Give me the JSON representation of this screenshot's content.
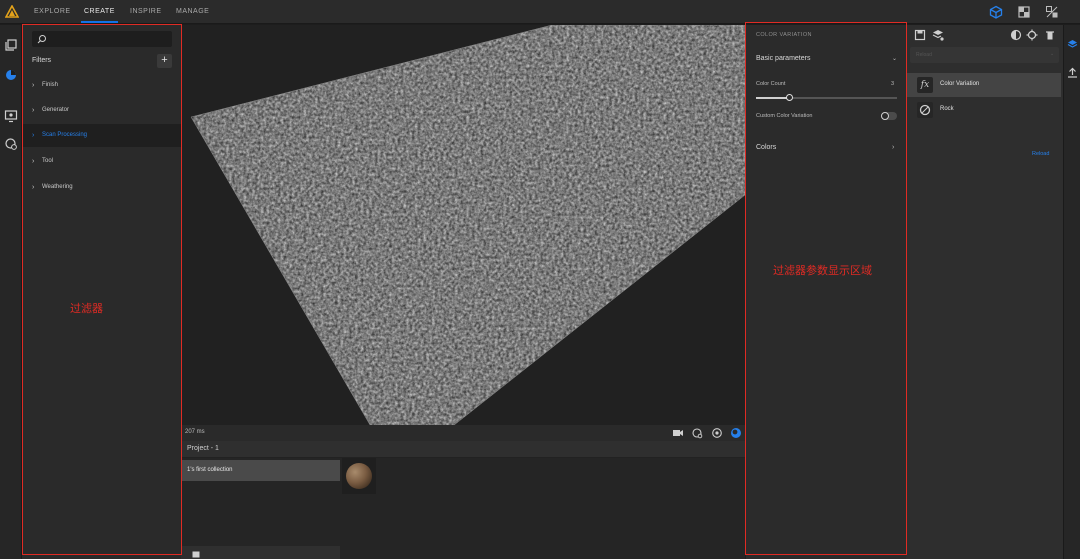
{
  "topbar": {
    "tabs": [
      "EXPLORE",
      "CREATE",
      "INSPIRE",
      "MANAGE"
    ],
    "active_tab": "CREATE"
  },
  "filters": {
    "search_placeholder": "",
    "title": "Filters",
    "add_label": "+",
    "categories": [
      "Finish",
      "Generator",
      "Scan Processing",
      "Tool",
      "Weathering"
    ],
    "active_category": "Scan Processing"
  },
  "viewport": {
    "timing": "207 ms"
  },
  "project": {
    "title": "Project - 1",
    "collection": "1's first collection"
  },
  "color_variation": {
    "panel_title": "COLOR VARIATION",
    "basic_parameters": "Basic parameters",
    "color_count_label": "Color Count",
    "color_count_value": "3",
    "slider_fraction": 0.24,
    "custom_label": "Custom Color Variation",
    "custom_enabled": false,
    "colors_label": "Colors"
  },
  "layers": {
    "dropdown_value": "Reload",
    "items": [
      {
        "label": "Color Variation",
        "icon": "fx-icon"
      },
      {
        "label": "Rock",
        "icon": "material-ball-icon"
      }
    ],
    "reload_label": "Reload"
  },
  "annotations": {
    "filters_note": "过滤器",
    "params_note": "过滤器参数显示区域"
  },
  "colors": {
    "accent": "#1473e6",
    "annotation_red": "#e02b24"
  }
}
